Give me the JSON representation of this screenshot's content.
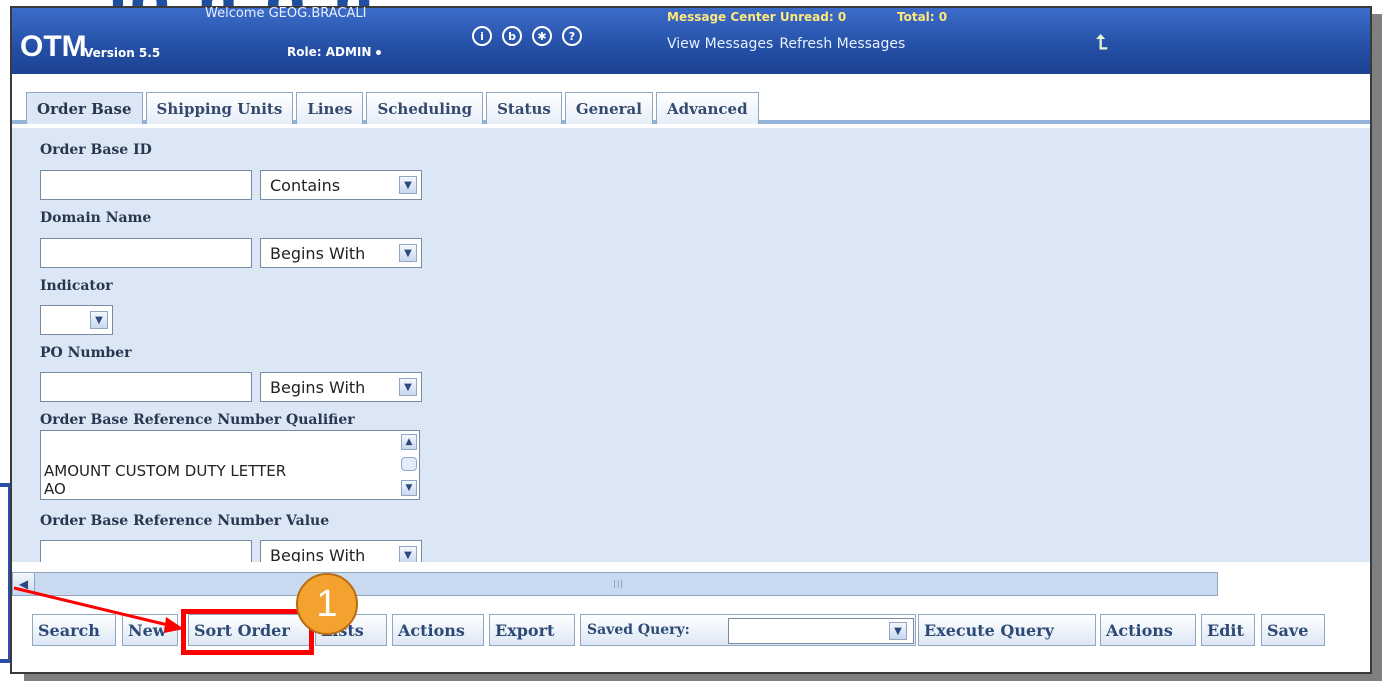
{
  "header": {
    "logo": "OTM",
    "version": "Version 5.5",
    "welcome": "Welcome GEOG.BRACALI",
    "role": "Role: ADMIN",
    "message_center": "Message Center Unread: 0",
    "total": "Total: 0",
    "view_messages": "View Messages",
    "refresh_messages": "Refresh Messages",
    "icons": [
      "info-icon",
      "bookmark-icon",
      "preferences-icon",
      "help-icon",
      "logout-arrow-icon"
    ]
  },
  "tabs": [
    {
      "label": "Order Base"
    },
    {
      "label": "Shipping Units"
    },
    {
      "label": "Lines"
    },
    {
      "label": "Scheduling"
    },
    {
      "label": "Status"
    },
    {
      "label": "General"
    },
    {
      "label": "Advanced"
    }
  ],
  "form": {
    "order_base_id": {
      "label": "Order Base ID",
      "value": "",
      "operator": "Contains"
    },
    "domain_name": {
      "label": "Domain Name",
      "value": "",
      "operator": "Begins With"
    },
    "indicator": {
      "label": "Indicator",
      "value": ""
    },
    "po_number": {
      "label": "PO Number",
      "value": "",
      "operator": "Begins With"
    },
    "ref_qualifier": {
      "label": "Order Base Reference Number Qualifier",
      "options": [
        "AMOUNT CUSTOM DUTY LETTER",
        "AO"
      ]
    },
    "ref_value": {
      "label": "Order Base Reference Number Value",
      "operator": "Begins With"
    }
  },
  "toolbar": {
    "search": "Search",
    "new": "New",
    "sort_order": "Sort Order",
    "lists": "Lists",
    "actions": "Actions",
    "export": "Export",
    "saved_query_label": "Saved Query:",
    "saved_query_value": "",
    "execute_query": "Execute Query",
    "actions2": "Actions",
    "edit": "Edit",
    "save": "Save"
  },
  "annotation": {
    "step_number": "1",
    "color": "#ff0000"
  },
  "colors": {
    "header_blue": "#244fa5",
    "panel_blue": "#dbe7f4",
    "highlight_red": "#ff0000",
    "badge_orange": "#f4a22f"
  }
}
